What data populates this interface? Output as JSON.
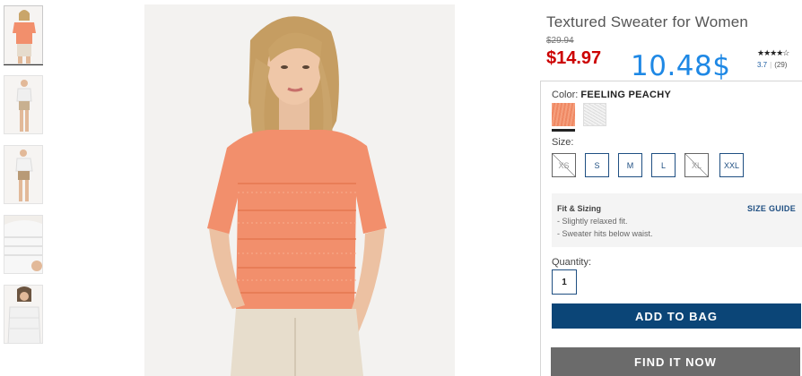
{
  "product": {
    "title": "Textured Sweater for Women",
    "original_price": "$29.94",
    "sale_price": "$14.97",
    "overlay_price": "10.48$",
    "rating": {
      "stars_text": "★★★★☆",
      "stars_value": 3.7,
      "score": "3.7",
      "separator": "|",
      "count": "(29)"
    }
  },
  "options": {
    "color_label": "Color:",
    "color_value": "FEELING PEACHY",
    "swatches": [
      {
        "name": "feeling-peachy",
        "selected": true,
        "color": "#f28f6c"
      },
      {
        "name": "white-textured",
        "selected": false,
        "color": "#e8e8e8"
      }
    ],
    "size_label": "Size:",
    "sizes": [
      {
        "label": "XS",
        "available": false
      },
      {
        "label": "S",
        "available": true
      },
      {
        "label": "M",
        "available": true
      },
      {
        "label": "L",
        "available": true
      },
      {
        "label": "XL",
        "available": false
      },
      {
        "label": "XXL",
        "available": true
      }
    ],
    "fit": {
      "title": "Fit & Sizing",
      "size_guide": "SIZE GUIDE",
      "lines": [
        "- Slightly relaxed fit.",
        "- Sweater hits below waist."
      ]
    },
    "quantity_label": "Quantity:",
    "quantity_value": "1"
  },
  "actions": {
    "add_to_bag": "ADD TO BAG",
    "find_it_now": "FIND IT NOW"
  },
  "colors": {
    "sale_red": "#cc0000",
    "overlay_blue": "#1e88e5",
    "primary_navy": "#0b4577",
    "secondary_gray": "#6b6b6b",
    "sweater_peach": "#f28f6c"
  }
}
